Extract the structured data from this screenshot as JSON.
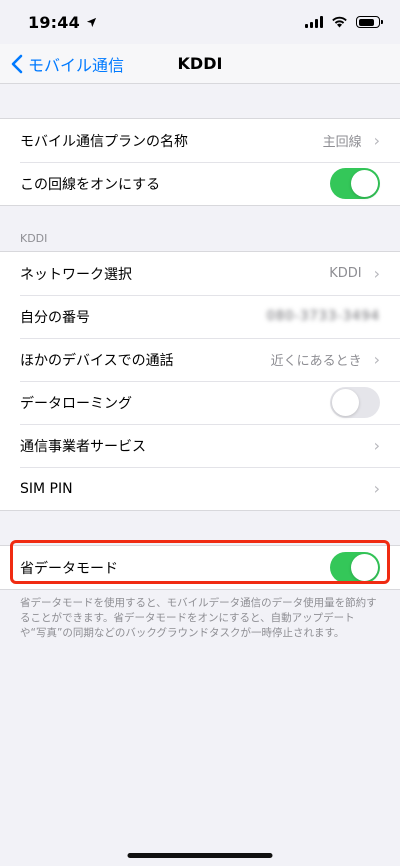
{
  "status_bar": {
    "time": "19:44",
    "location_icon": "location-arrow-icon",
    "signal_icon": "signal-bars-icon",
    "wifi_icon": "wifi-icon",
    "battery_icon": "battery-icon"
  },
  "nav": {
    "back_label": "モバイル通信",
    "title": "KDDI"
  },
  "group_plan": {
    "plan_label": "モバイル通信プランの名称",
    "plan_value": "主回線",
    "line_label": "この回線をオンにする",
    "line_on": true
  },
  "group_kddi": {
    "header": "KDDI",
    "network_label": "ネットワーク選択",
    "network_value": "KDDI",
    "number_label": "自分の番号",
    "number_value": "080-3733-3494",
    "other_devices_label": "ほかのデバイスでの通話",
    "other_devices_value": "近くにあるとき",
    "roaming_label": "データローミング",
    "roaming_on": false,
    "carrier_label": "通信事業者サービス",
    "simpin_label": "SIM PIN"
  },
  "group_lowdata": {
    "label": "省データモード",
    "on": true,
    "footer": "省データモードを使用すると、モバイルデータ通信のデータ使用量を節約することができます。省データモードをオンにすると、自動アップデートや“写真”の同期などのバックグラウンドタスクが一時停止されます。"
  },
  "colors": {
    "accent": "#007aff",
    "toggle_on": "#34c759",
    "highlight": "#f02b12",
    "background": "#f2f2f7"
  }
}
